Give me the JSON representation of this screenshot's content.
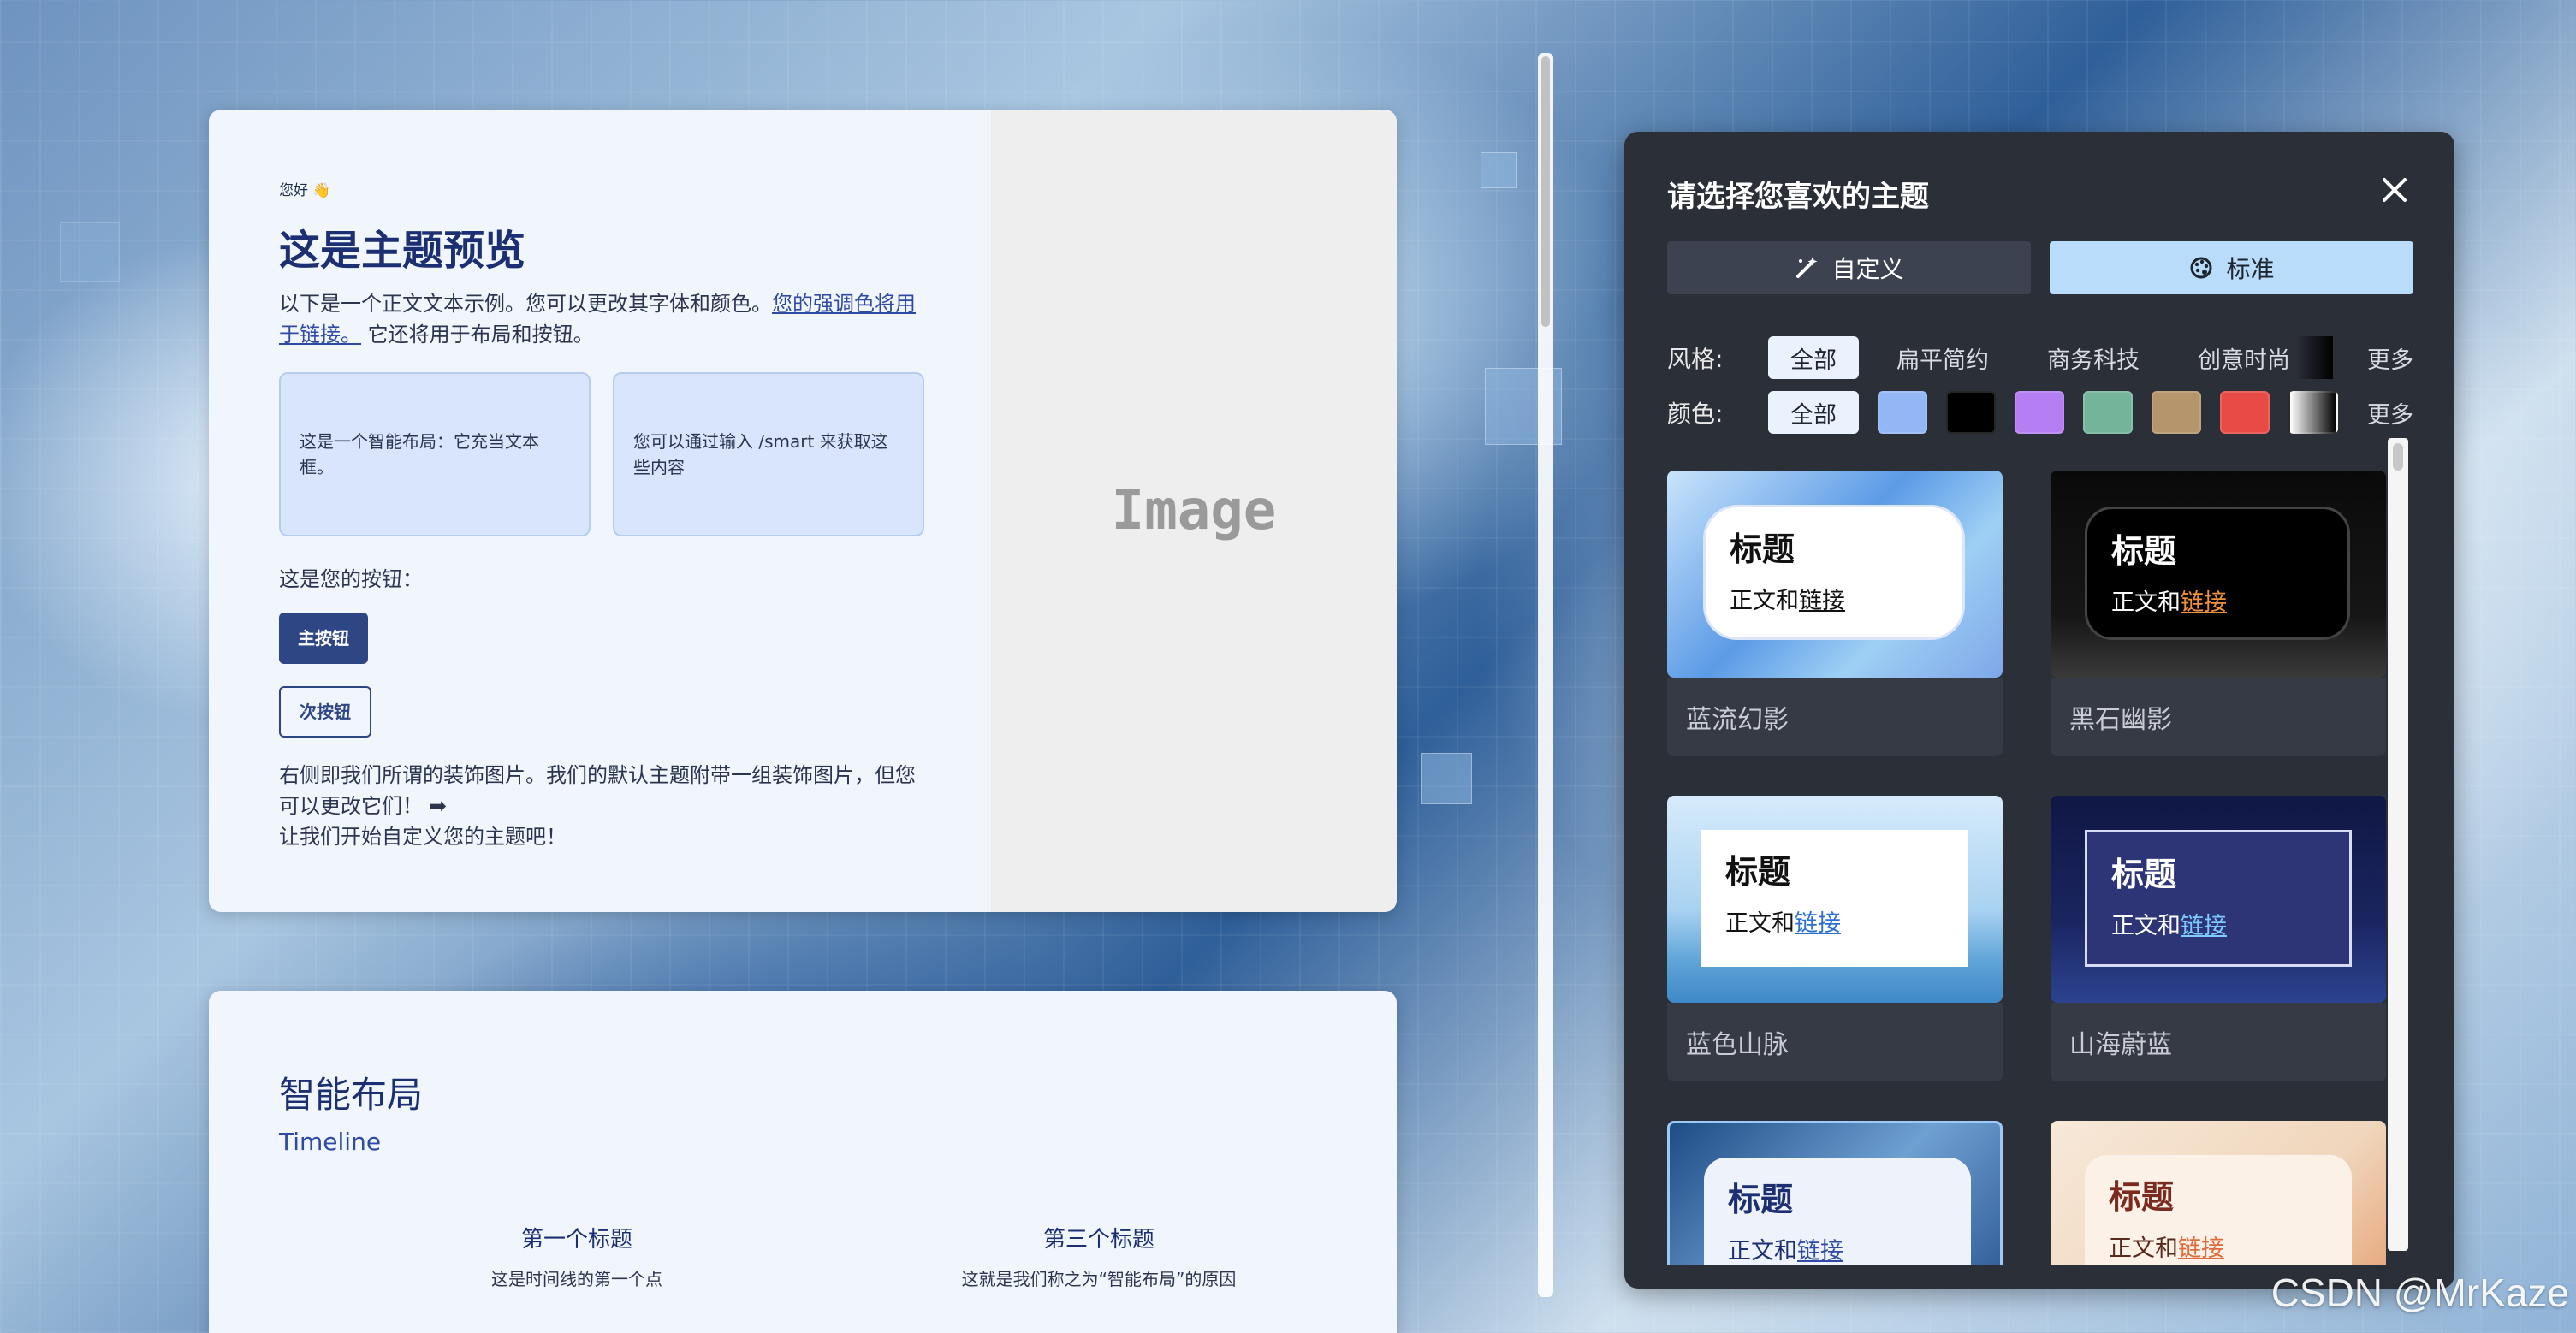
{
  "preview": {
    "greeting": "您好 👋",
    "title": "这是主题预览",
    "body_prefix": "以下是一个正文文本示例。您可以更改其字体和颜色。",
    "body_link": "您的强调色将用于链接。",
    "body_suffix": " 它还将用于布局和按钮。",
    "smart_box_1": "这是一个智能布局：它充当文本框。",
    "smart_box_2": "您可以通过输入 /smart 来获取这些内容",
    "buttons_label": "这是您的按钮：",
    "primary_button": "主按钮",
    "secondary_button": "次按钮",
    "closing_line_1": "右侧即我们所谓的装饰图片。我们的默认主题附带一组装饰图片，但您可以更改它们！ ➡",
    "closing_line_2": "让我们开始自定义您的主题吧！",
    "image_placeholder": "Image"
  },
  "smart_layout": {
    "title": "智能布局",
    "subtitle": "Timeline",
    "items": [
      {
        "heading": "第一个标题",
        "desc": "这是时间线的第一个点"
      },
      {
        "heading": "第三个标题",
        "desc": "这就是我们称之为“智能布局”的原因"
      }
    ]
  },
  "dialog": {
    "title": "请选择您喜欢的主题",
    "tabs": [
      {
        "label": "自定义",
        "icon": "magic-wand-icon",
        "active": false
      },
      {
        "label": "标准",
        "icon": "palette-icon",
        "active": true
      }
    ],
    "style_filter": {
      "label": "风格:",
      "all": "全部",
      "options": [
        "扁平简约",
        "商务科技",
        "创意时尚"
      ],
      "more": "更多"
    },
    "color_filter": {
      "label": "颜色:",
      "all": "全部",
      "swatches": [
        "#93b7f5",
        "#000000",
        "#b57ef2",
        "#74b49a",
        "#b4956c",
        "#e84b45",
        "gradient"
      ],
      "more": "更多"
    },
    "themes": [
      {
        "name": "蓝流幻影",
        "thumb_title": "标题",
        "thumb_body": "正文和",
        "thumb_link": "链接"
      },
      {
        "name": "黑石幽影",
        "thumb_title": "标题",
        "thumb_body": "正文和",
        "thumb_link": "链接"
      },
      {
        "name": "蓝色山脉",
        "thumb_title": "标题",
        "thumb_body": "正文和",
        "thumb_link": "链接"
      },
      {
        "name": "山海蔚蓝",
        "thumb_title": "标题",
        "thumb_body": "正文和",
        "thumb_link": "链接"
      },
      {
        "name": "",
        "thumb_title": "标题",
        "thumb_body": "正文和",
        "thumb_link": "链接"
      },
      {
        "name": "",
        "thumb_title": "标题",
        "thumb_body": "正文和",
        "thumb_link": "链接"
      }
    ]
  },
  "watermark": "CSDN @MrKaze"
}
